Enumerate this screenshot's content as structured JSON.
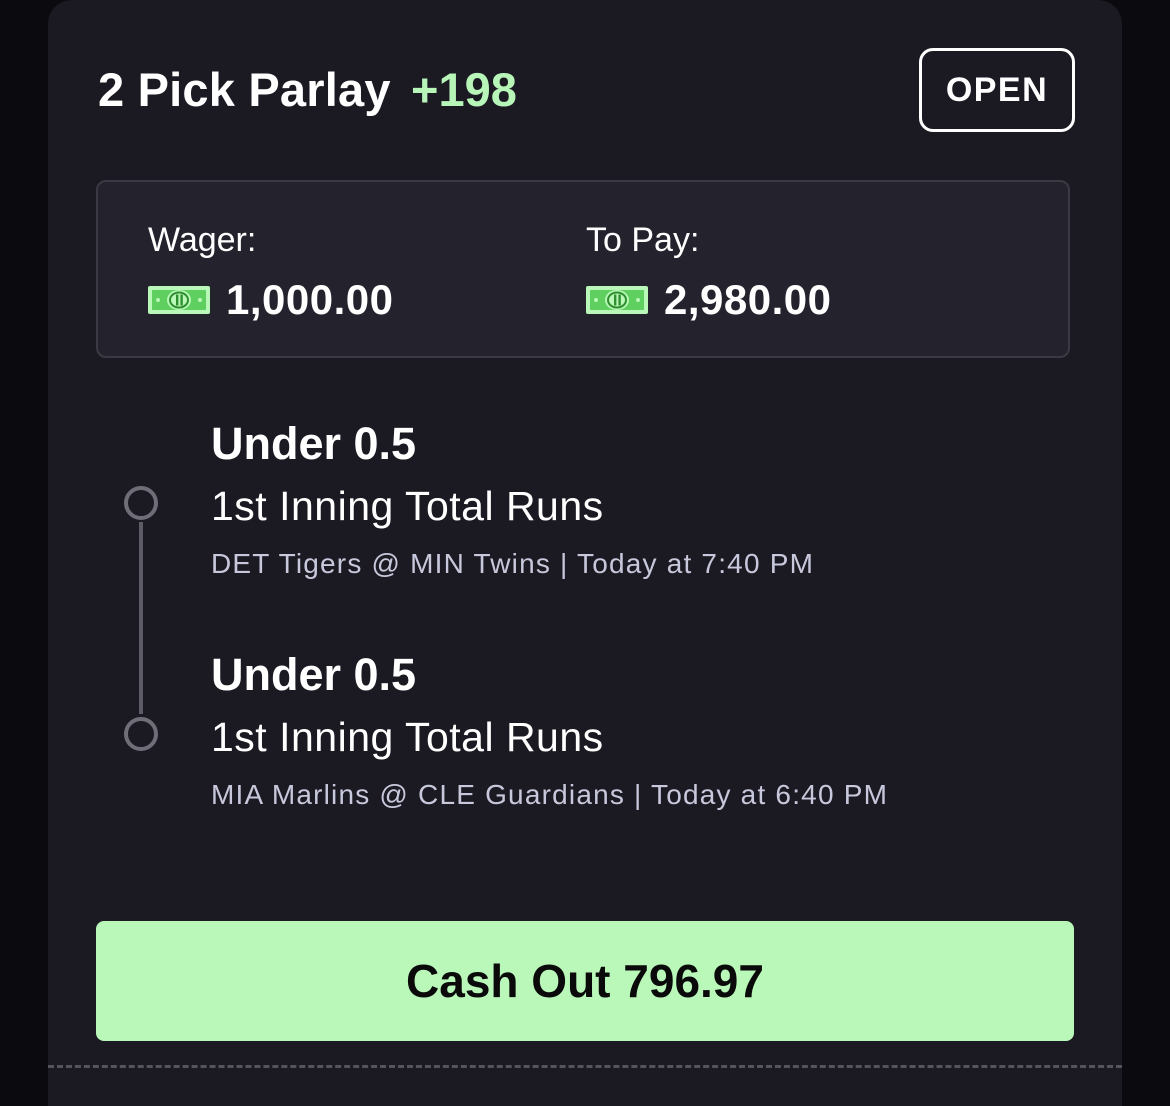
{
  "bet": {
    "title": "2 Pick Parlay",
    "odds": "+198",
    "status": "OPEN"
  },
  "wager": {
    "label": "Wager:",
    "amount": "1,000.00",
    "icon": "cash-bill-icon"
  },
  "payout": {
    "label": "To Pay:",
    "amount": "2,980.00",
    "icon": "cash-bill-icon"
  },
  "legs": [
    {
      "pick": "Under 0.5",
      "market": "1st Inning Total Runs",
      "game": "DET Tigers @ MIN Twins | Today at 7:40 PM"
    },
    {
      "pick": "Under 0.5",
      "market": "1st Inning Total Runs",
      "game": "MIA Marlins @ CLE Guardians | Today at 6:40 PM"
    }
  ],
  "cashout": {
    "label": "Cash Out 796.97"
  },
  "colors": {
    "accent_green": "#b9f8b9",
    "card_bg": "#1b1a22",
    "page_bg": "#0a0a0f"
  }
}
